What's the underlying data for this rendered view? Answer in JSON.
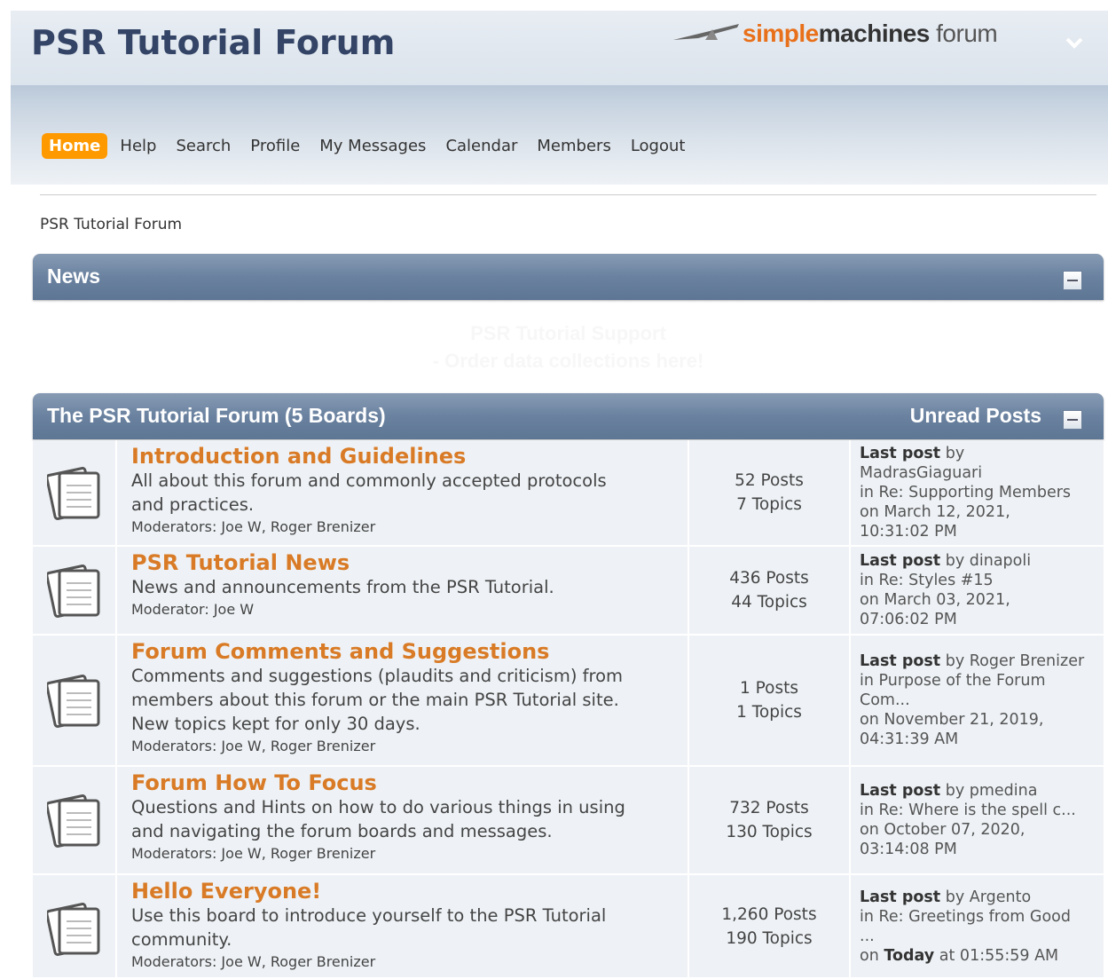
{
  "header": {
    "title": "PSR Tutorial Forum",
    "logo": {
      "simple": "simple",
      "machines": "machines",
      "forum": " forum"
    }
  },
  "menu": [
    "Home",
    "Help",
    "Search",
    "Profile",
    "My Messages",
    "Calendar",
    "Members",
    "Logout"
  ],
  "breadcrumb": "PSR Tutorial Forum",
  "news": {
    "title": "News",
    "lines": [
      "PSR Tutorial Support",
      "- Order data collections here!"
    ]
  },
  "category": {
    "title": "The PSR Tutorial Forum (5 Boards)",
    "unread": "Unread Posts"
  },
  "boards": [
    {
      "name": "Introduction and Guidelines",
      "desc": [
        "All about this forum and commonly accepted protocols",
        "and practices."
      ],
      "mods": "Moderators: Joe W, Roger Brenizer",
      "posts": "52 Posts",
      "topics": "7 Topics",
      "last": [
        "Last post",
        " by",
        "MadrasGiaguari",
        "in Re: Supporting Members",
        "on March 12, 2021,",
        "10:31:02 PM"
      ]
    },
    {
      "name": "PSR Tutorial News",
      "desc": [
        "News and announcements from the PSR Tutorial."
      ],
      "mods": "Moderator: Joe W",
      "posts": "436 Posts",
      "topics": "44 Topics",
      "last": [
        "Last post",
        " by dinapoli",
        "in Re: Styles #15",
        "on March 03, 2021,",
        "07:06:02 PM"
      ]
    },
    {
      "name": "Forum Comments and Suggestions",
      "desc": [
        "Comments and suggestions (plaudits and criticism) from",
        "members about this forum or the main PSR Tutorial site.",
        "New topics kept for only 30 days."
      ],
      "mods": "Moderators: Joe W, Roger Brenizer",
      "posts": "1 Posts",
      "topics": "1 Topics",
      "last": [
        "Last post",
        " by Roger Brenizer",
        "in Purpose of the Forum",
        "Com...",
        "on November 21, 2019,",
        "04:31:39 AM"
      ]
    },
    {
      "name": "Forum How To Focus",
      "desc": [
        "Questions and Hints on how to do various things in using",
        "and navigating the forum boards and messages."
      ],
      "mods": "Moderators: Joe W, Roger Brenizer",
      "posts": "732 Posts",
      "topics": "130 Topics",
      "last": [
        "Last post",
        " by pmedina",
        "in Re: Where is the spell c...",
        "on October 07, 2020,",
        "03:14:08 PM"
      ]
    },
    {
      "name": "Hello Everyone!",
      "desc": [
        "Use this board to introduce yourself to the PSR Tutorial",
        "community."
      ],
      "mods": "Moderators: Joe W, Roger Brenizer",
      "posts": "1,260 Posts",
      "topics": "190 Topics",
      "last": [
        "Last post",
        " by Argento",
        "in Re: Greetings from Good",
        "...",
        "on ",
        "Today",
        " at 01:55:59 AM"
      ]
    }
  ]
}
